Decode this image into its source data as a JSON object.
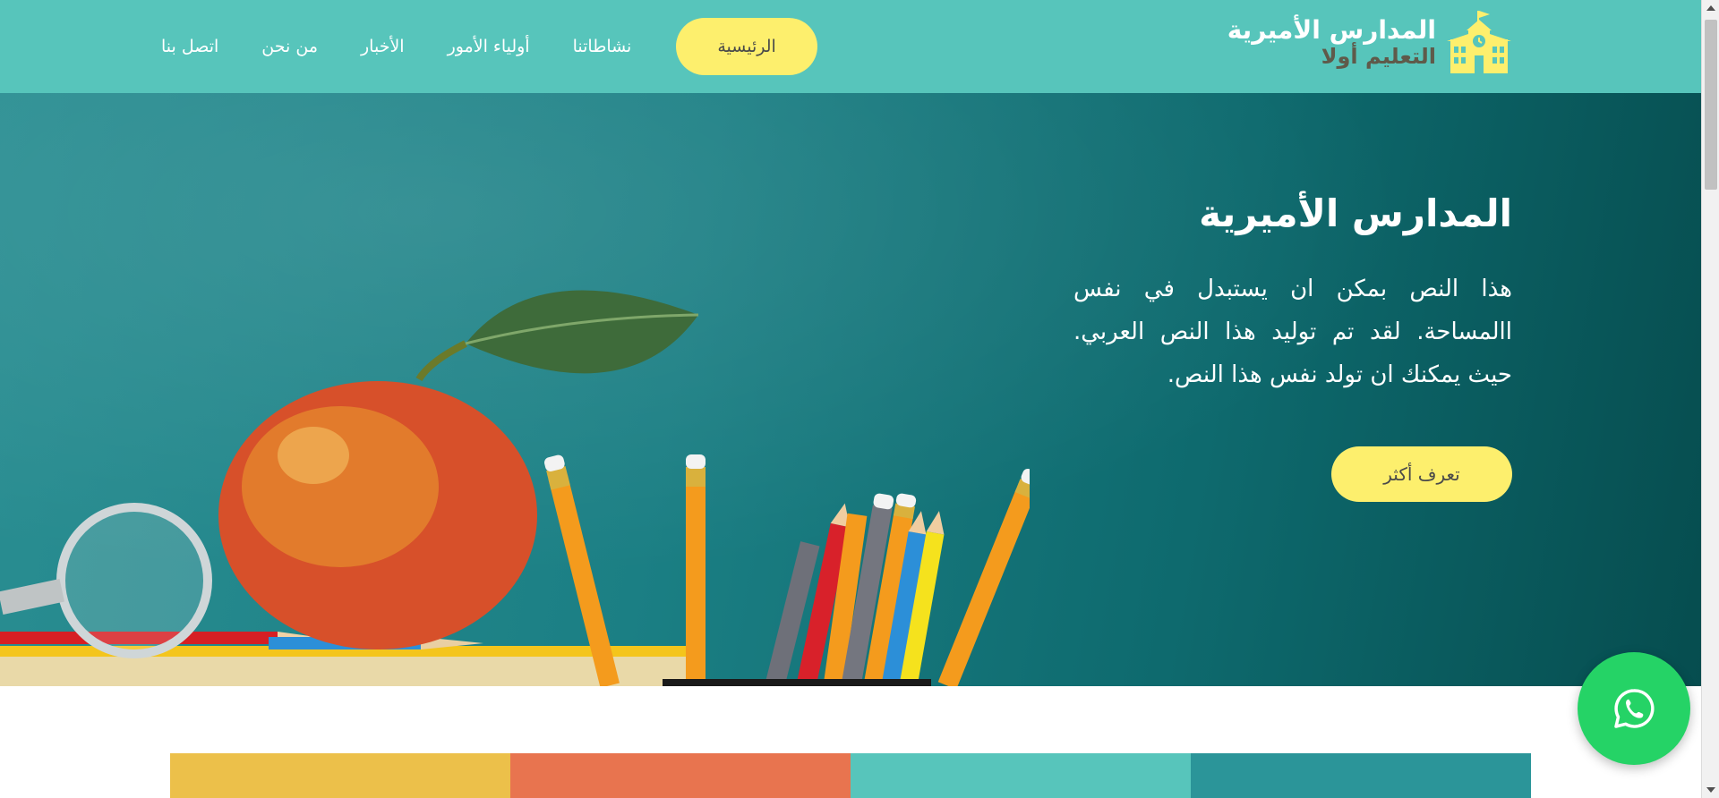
{
  "brand": {
    "title": "المدارس الأميرية",
    "tagline": "التعليم أولا",
    "icon": "school-building-icon"
  },
  "nav": {
    "items": [
      {
        "label": "الرئيسية",
        "active": true
      },
      {
        "label": "نشاطاتنا",
        "active": false
      },
      {
        "label": "أولياء الأمور",
        "active": false
      },
      {
        "label": "الأخبار",
        "active": false
      },
      {
        "label": "من نحن",
        "active": false
      },
      {
        "label": "اتصل بنا",
        "active": false
      }
    ]
  },
  "hero": {
    "title": "المدارس الأميرية",
    "text": "هذا النص بمكن ان يستبدل في نفس االمساحة. لقد تم توليد هذا النص العربي. حيث يمكنك ان تولد نفس هذا النص.",
    "button_label": "تعرف أكثر",
    "image": "apple-pencils-chalkboard"
  },
  "colors": {
    "header": "#57c5bb",
    "accent_yellow": "#fdef6d",
    "strip": [
      "#ecc04a",
      "#e8744f",
      "#57c5bb",
      "#2b9599"
    ],
    "whatsapp": "#25d366"
  },
  "floating": {
    "whatsapp_icon": "whatsapp-icon"
  }
}
